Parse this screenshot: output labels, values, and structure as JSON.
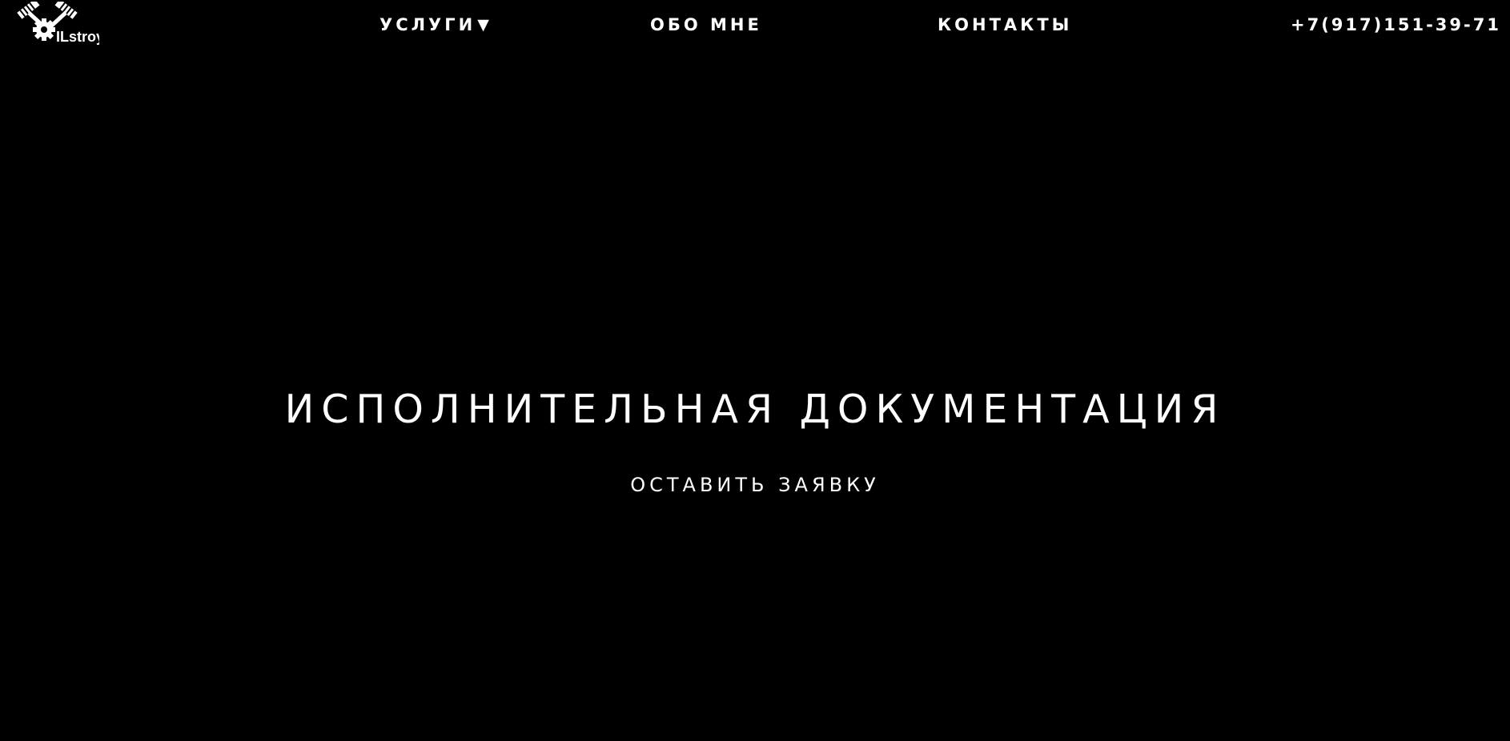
{
  "header": {
    "logo_text": "ILstroy",
    "nav": {
      "services_label": "УСЛУГИ",
      "services_caret": "▼",
      "about_label": "ОБО МНЕ",
      "contacts_label": "КОНТАКТЫ"
    },
    "phone": "+7(917)151-39-71"
  },
  "hero": {
    "title": "ИСПОЛНИТЕЛЬНАЯ ДОКУМЕНТАЦИЯ",
    "cta_label": "ОСТАВИТЬ ЗАЯВКУ"
  },
  "colors": {
    "background": "#000000",
    "text": "#ffffff"
  },
  "icons": {
    "logo_icon": "crossed-hammers-gear-icon"
  }
}
